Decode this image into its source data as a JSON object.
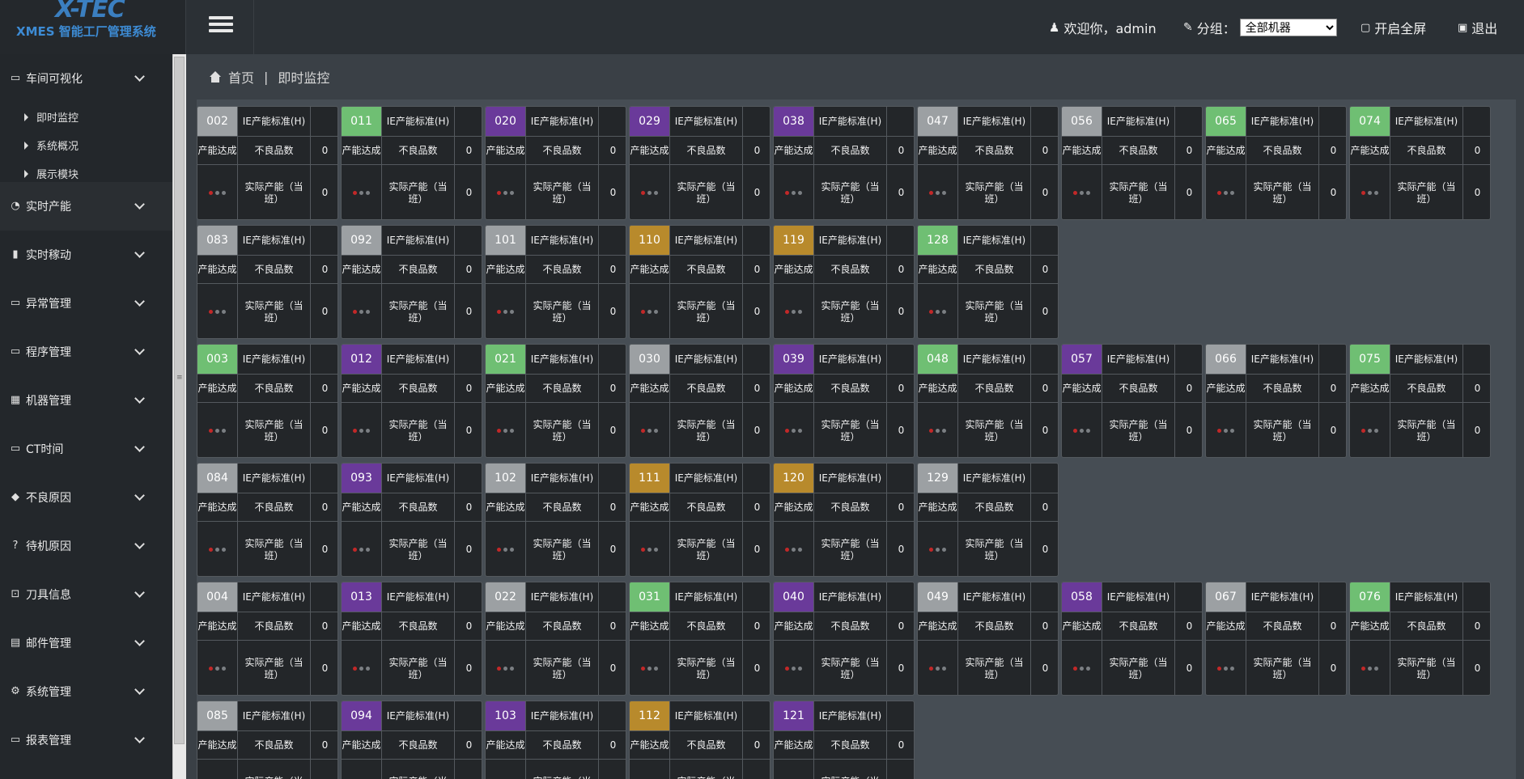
{
  "header": {
    "logo_mark": "X-TEC",
    "logo_name": "XMES 智能工厂管理系统",
    "welcome": "欢迎你，admin",
    "group_label": "分组：",
    "group_selected": "全部机器",
    "fullscreen": "开启全屏",
    "logout": "退出"
  },
  "breadcrumb": {
    "home": "首页",
    "separator": "|",
    "current": "即时监控"
  },
  "sidebar": {
    "items": [
      {
        "label": "车间可视化",
        "icon": "monitor-icon",
        "glyph": "▭"
      },
      {
        "label": "实时产能",
        "icon": "pie-chart-icon",
        "glyph": "◔"
      },
      {
        "label": "实时稼动",
        "icon": "bar-chart-icon",
        "glyph": "▮"
      },
      {
        "label": "异常管理",
        "icon": "desktop-icon",
        "glyph": "▭"
      },
      {
        "label": "程序管理",
        "icon": "code-window-icon",
        "glyph": "▭"
      },
      {
        "label": "机器管理",
        "icon": "grid-icon",
        "glyph": "▦"
      },
      {
        "label": "CT时间",
        "icon": "terminal-icon",
        "glyph": "▭"
      },
      {
        "label": "不良原因",
        "icon": "warning-diamond-icon",
        "glyph": "◆"
      },
      {
        "label": "待机原因",
        "icon": "question-icon",
        "glyph": "?"
      },
      {
        "label": "刀具信息",
        "icon": "tool-upload-icon",
        "glyph": "⊡"
      },
      {
        "label": "邮件管理",
        "icon": "mail-icon",
        "glyph": "▤"
      },
      {
        "label": "系统管理",
        "icon": "gear-icon",
        "glyph": "⚙"
      },
      {
        "label": "报表管理",
        "icon": "report-icon",
        "glyph": "▭"
      }
    ],
    "subitems": [
      "即时监控",
      "系统概况",
      "展示模块"
    ]
  },
  "card_labels": {
    "std": "IE产能标准(H)",
    "achieve": "产能达成",
    "defect": "不良品数",
    "actual": "实际产能（当班）"
  },
  "colors": {
    "gray": "#9ca0a3",
    "green": "#6fbf73",
    "purple": "#6a3a9a",
    "gold": "#b88a2c"
  },
  "machine_rows": [
    [
      {
        "id": "002",
        "c": "gray"
      },
      {
        "id": "011",
        "c": "green"
      },
      {
        "id": "020",
        "c": "purple"
      },
      {
        "id": "029",
        "c": "purple"
      },
      {
        "id": "038",
        "c": "purple"
      },
      {
        "id": "047",
        "c": "gray"
      },
      {
        "id": "056",
        "c": "gray"
      },
      {
        "id": "065",
        "c": "green"
      },
      {
        "id": "074",
        "c": "green"
      }
    ],
    [
      {
        "id": "083",
        "c": "gray"
      },
      {
        "id": "092",
        "c": "gray"
      },
      {
        "id": "101",
        "c": "gray"
      },
      {
        "id": "110",
        "c": "gold"
      },
      {
        "id": "119",
        "c": "gold"
      },
      {
        "id": "128",
        "c": "green"
      }
    ],
    [
      {
        "id": "003",
        "c": "green"
      },
      {
        "id": "012",
        "c": "purple"
      },
      {
        "id": "021",
        "c": "green"
      },
      {
        "id": "030",
        "c": "gray"
      },
      {
        "id": "039",
        "c": "purple"
      },
      {
        "id": "048",
        "c": "green"
      },
      {
        "id": "057",
        "c": "purple"
      },
      {
        "id": "066",
        "c": "gray"
      },
      {
        "id": "075",
        "c": "green"
      }
    ],
    [
      {
        "id": "084",
        "c": "gray"
      },
      {
        "id": "093",
        "c": "purple"
      },
      {
        "id": "102",
        "c": "gray"
      },
      {
        "id": "111",
        "c": "gold"
      },
      {
        "id": "120",
        "c": "gold"
      },
      {
        "id": "129",
        "c": "gray"
      }
    ],
    [
      {
        "id": "004",
        "c": "gray"
      },
      {
        "id": "013",
        "c": "purple"
      },
      {
        "id": "022",
        "c": "gray"
      },
      {
        "id": "031",
        "c": "green"
      },
      {
        "id": "040",
        "c": "purple"
      },
      {
        "id": "049",
        "c": "gray"
      },
      {
        "id": "058",
        "c": "purple"
      },
      {
        "id": "067",
        "c": "gray"
      },
      {
        "id": "076",
        "c": "green"
      }
    ],
    [
      {
        "id": "085",
        "c": "gray"
      },
      {
        "id": "094",
        "c": "purple"
      },
      {
        "id": "103",
        "c": "purple"
      },
      {
        "id": "112",
        "c": "gold"
      },
      {
        "id": "121",
        "c": "purple"
      }
    ]
  ],
  "defect_value": "0",
  "actual_value": "0"
}
